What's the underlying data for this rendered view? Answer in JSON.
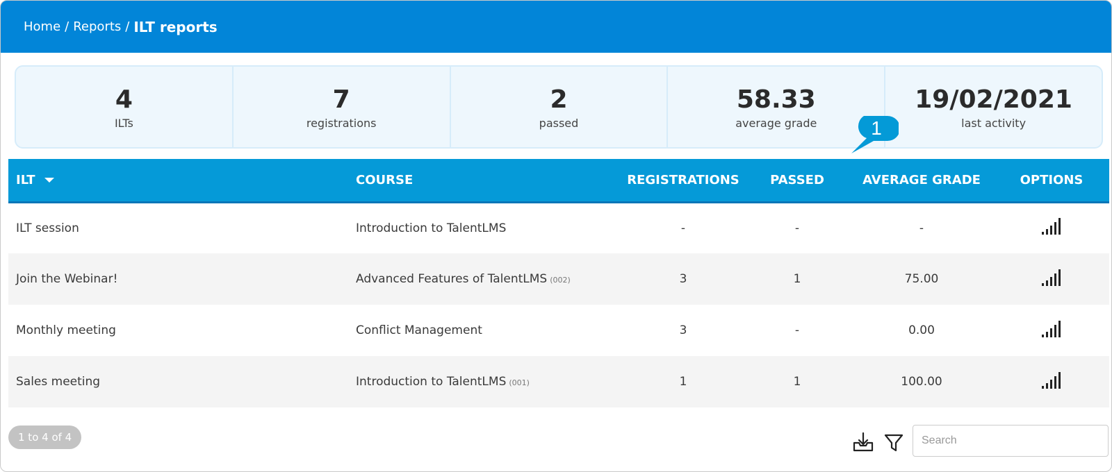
{
  "breadcrumb": {
    "home": "Home",
    "reports": "Reports",
    "separator": "/",
    "current": "ILT reports"
  },
  "stats": [
    {
      "value": "4",
      "label": "ILTs"
    },
    {
      "value": "7",
      "label": "registrations"
    },
    {
      "value": "2",
      "label": "passed"
    },
    {
      "value": "58.33",
      "label": "average grade"
    },
    {
      "value": "19/02/2021",
      "label": "last activity"
    }
  ],
  "callout": {
    "number": "1",
    "color": "#049ad7"
  },
  "table": {
    "headers": {
      "ilt": "ILT",
      "course": "COURSE",
      "registrations": "REGISTRATIONS",
      "passed": "PASSED",
      "average_grade": "AVERAGE GRADE",
      "options": "OPTIONS"
    },
    "sort_icon": "caret-down-icon",
    "rows": [
      {
        "ilt": "ILT session",
        "course": "Introduction to TalentLMS",
        "code": "",
        "registrations": "-",
        "passed": "-",
        "average_grade": "-"
      },
      {
        "ilt": "Join the Webinar!",
        "course": "Advanced Features of TalentLMS",
        "code": "(002)",
        "registrations": "3",
        "passed": "1",
        "average_grade": "75.00"
      },
      {
        "ilt": "Monthly meeting",
        "course": "Conflict Management",
        "code": "",
        "registrations": "3",
        "passed": "-",
        "average_grade": "0.00"
      },
      {
        "ilt": "Sales meeting",
        "course": "Introduction to TalentLMS",
        "code": "(001)",
        "registrations": "1",
        "passed": "1",
        "average_grade": "100.00"
      }
    ],
    "option_icon": "bar-chart-icon"
  },
  "footer": {
    "pagination": "1 to 4 of 4",
    "download_icon": "download-tray-icon",
    "filter_icon": "filter-funnel-icon",
    "search_placeholder": "Search"
  },
  "colors": {
    "topbar": "#0285d8",
    "table_header": "#059ad8",
    "stats_bg": "#eef7fd"
  }
}
